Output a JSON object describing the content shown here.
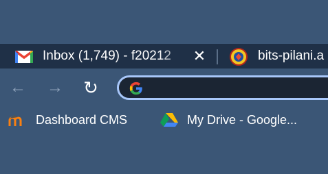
{
  "tabs": [
    {
      "title": "Inbox (1,749) - f20212",
      "icon": "gmail-icon",
      "active": true
    },
    {
      "title": "bits-pilani.a",
      "icon": "bits-pilani-logo-icon",
      "active": false
    }
  ],
  "close_symbol": "✕",
  "toolbar": {
    "back_symbol": "←",
    "forward_symbol": "→",
    "reload_symbol": "↻",
    "omnibox_value": ""
  },
  "bookmarks": [
    {
      "label": "Dashboard CMS",
      "icon": "moodle-icon"
    },
    {
      "label": "My Drive - Google...",
      "icon": "google-drive-icon"
    }
  ],
  "colors": {
    "frame": "#3b5676",
    "tabstrip": "#1f3047",
    "omnibox_border": "#a8c7fa"
  }
}
